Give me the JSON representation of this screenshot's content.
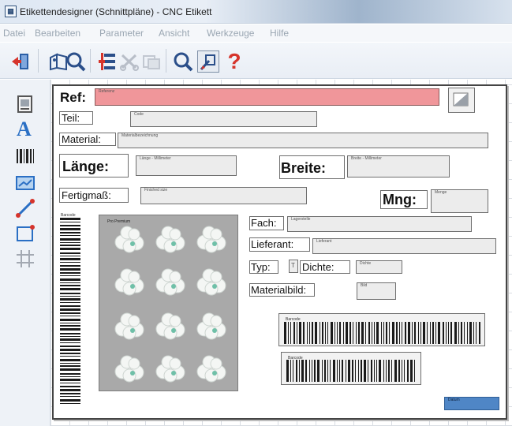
{
  "window": {
    "title": "Etikettendesigner (Schnittpläne) - CNC Etikett"
  },
  "menu": [
    "Datei",
    "Bearbeiten",
    "Parameter",
    "Ansicht",
    "Werkzeuge",
    "Hilfe"
  ],
  "toolbar": {
    "items": [
      "exit-icon",
      "open-icon",
      "preview-icon",
      "align-icon",
      "cut-icon",
      "copy-icon",
      "zoom-icon",
      "draw-icon",
      "help-icon"
    ],
    "help_glyph": "?"
  },
  "tools": [
    "image-tool-icon",
    "text-tool-icon",
    "barcode-tool-icon",
    "field-tool-icon",
    "line-tool-icon",
    "rectangle-tool-icon",
    "grid-tool-icon"
  ],
  "label": {
    "ref_label": "Ref:",
    "ref_field": "Referenz",
    "teil_label": "Teil:",
    "teil_field": "Code",
    "material_label": "Material:",
    "material_field": "Materialbezeichnung",
    "laenge_label": "Länge:",
    "laenge_field": "Länge - Millimeter",
    "breite_label": "Breite:",
    "breite_field": "Breite - Millimeter",
    "fertigmass_label": "Fertigmaß:",
    "fertigmass_field": "Finished size",
    "mng_label": "Mng:",
    "mng_field": "Menge",
    "barcode_vertical_caption": "Barcode",
    "photo_caption": "Pro Premium",
    "fach_label": "Fach:",
    "fach_field": "Lagerstelle",
    "lieferant_label": "Lieferant:",
    "lieferant_field": "Lieferant",
    "typ_label": "Typ:",
    "typ_field": "T",
    "dichte_label": "Dichte:",
    "dichte_field": "Dichte",
    "materialbild_label": "Materialbild:",
    "materialbild_field": "Bild",
    "barcode1_caption": "Barcode",
    "barcode2_caption": "Barcode",
    "datum_field": "Datum"
  },
  "colors": {
    "ref_field": "#f0969a",
    "datum_field": "#4f86c6",
    "titlebar_accent": "#9fb4cc"
  }
}
